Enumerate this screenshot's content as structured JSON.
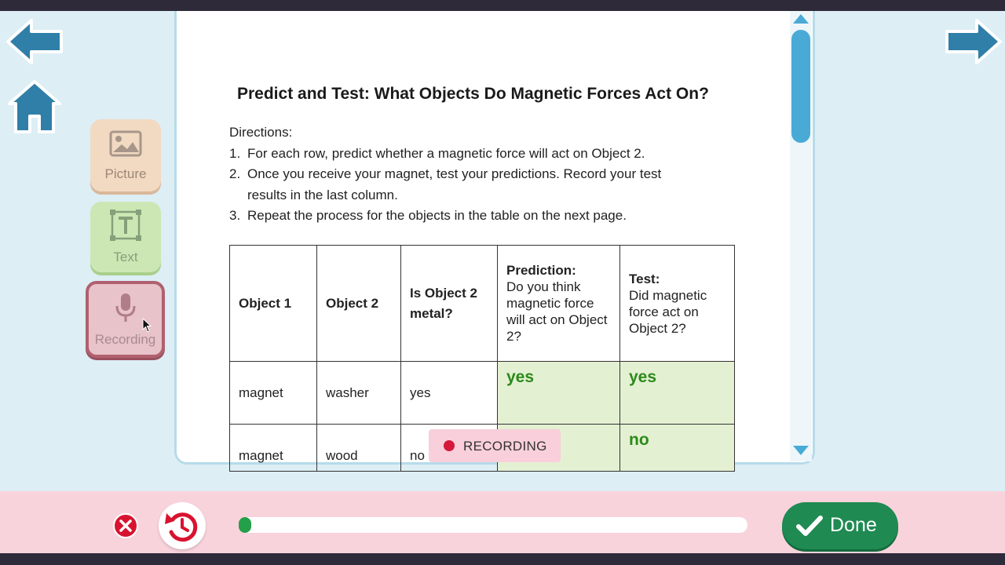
{
  "nav": {
    "back_icon": "arrow-left-icon",
    "forward_icon": "arrow-right-icon",
    "home_icon": "home-icon"
  },
  "tools": [
    {
      "label": "Picture",
      "icon": "image-icon"
    },
    {
      "label": "Text",
      "icon": "text-box-icon"
    },
    {
      "label": "Recording",
      "icon": "microphone-icon"
    }
  ],
  "document": {
    "title": "Predict and Test: What Objects Do Magnetic Forces Act On?",
    "directions_heading": "Directions:",
    "steps": [
      {
        "num": "1.",
        "text": "For each row, predict whether a magnetic force will act on Object 2."
      },
      {
        "num": "2.",
        "text": "Once you receive your magnet, test your predictions. Record your test",
        "cont": "results in the last column."
      },
      {
        "num": "3.",
        "text": "Repeat the process for the objects in the table on the next page."
      }
    ],
    "table": {
      "headers": {
        "object1": "Object 1",
        "object2": "Object 2",
        "metal": "Is Object 2 metal?",
        "prediction_bold": "Prediction:",
        "prediction_text": "Do you think magnetic force will act on Object 2?",
        "test_bold": "Test:",
        "test_text": "Did magnetic force act on Object 2?"
      },
      "rows": [
        {
          "object1": "magnet",
          "object2": "washer",
          "metal": "yes",
          "prediction": "yes",
          "test": "yes"
        },
        {
          "object1": "magnet",
          "object2": "wood",
          "metal": "no",
          "prediction": "",
          "test": "no"
        }
      ]
    }
  },
  "recording_badge": {
    "label": "RECORDING"
  },
  "bottom": {
    "close_icon": "close-icon",
    "undo_icon": "undo-icon",
    "progress": 0.0,
    "done_label": "Done",
    "done_icon": "checkmark-icon"
  },
  "colors": {
    "accent_blue": "#2f7fa8",
    "done_green": "#1f8a52",
    "answer_green": "#2a8a1a",
    "record_red": "#d4193d"
  }
}
